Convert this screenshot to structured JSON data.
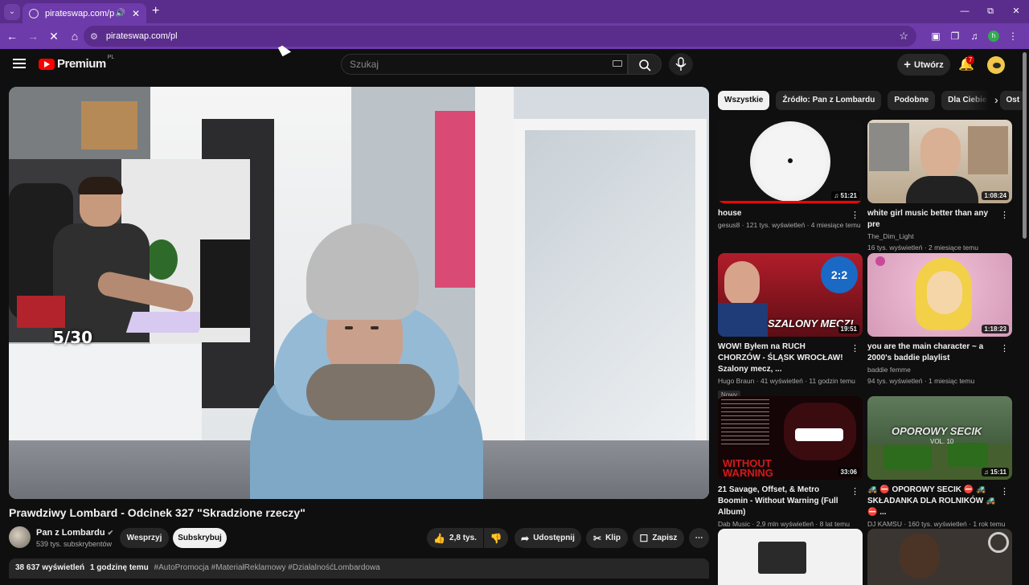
{
  "browser": {
    "tab_title": "pirateswap.com/pl",
    "url": "pirateswap.com/pl"
  },
  "youtube": {
    "logo_text": "Premium",
    "logo_country": "PL",
    "search_placeholder": "Szukaj",
    "create_label": "Utwórz",
    "notification_count": "7"
  },
  "video": {
    "title": "Prawdziwy Lombard - Odcinek 327 \"Skradzione rzeczy\"",
    "overlay_counter": "5/30",
    "channel_name": "Pan z Lombardu",
    "subscribers": "539 tys. subskrybentów",
    "support_label": "Wesprzyj",
    "subscribe_label": "Subskrybuj",
    "likes": "2,8 tys.",
    "share_label": "Udostępnij",
    "clip_label": "Klip",
    "save_label": "Zapisz",
    "views": "38 637 wyświetleń",
    "time": "1 godzinę temu",
    "tags": "#AutoPromocja #MateriałReklamowy #DziałalnośćLombardowa"
  },
  "chips": [
    "Wszystkie",
    "Źródło: Pan z Lombardu",
    "Podobne",
    "Dla Ciebie",
    "Ost"
  ],
  "recommendations": [
    {
      "title": "house",
      "channel": "gesus8",
      "stats": "121 tys. wyświetleń · 4 miesiące temu",
      "duration": "51:21",
      "progress": 1.0
    },
    {
      "title": "white girl music better than any pre",
      "channel": "The_Dim_Light",
      "stats": "16 tys. wyświetleń · 2 miesiące temu",
      "duration": "1:08:24"
    },
    {
      "title": "WOW! Byłem na RUCH CHORZÓW - ŚLĄSK WROCŁAW! Szalony mecz, ...",
      "channel": "Hugo Braun",
      "stats": "41 wyświetleń · 11 godzin temu",
      "duration": "19:51",
      "badge": "Nowy",
      "thumb_text": "SZALONY MECZ!",
      "thumb_score": "2:2"
    },
    {
      "title": "you are the main character ~ a 2000's baddie playlist",
      "channel": "baddie femme",
      "stats": "94 tys. wyświetleń · 1 miesiąc temu",
      "duration": "1:18:23"
    },
    {
      "title": "21 Savage, Offset, & Metro Boomin - Without Warning (Full Album)",
      "channel": "Dab Music",
      "stats": "2,9 mln wyświetleń · 8 lat temu",
      "duration": "33:06",
      "thumb_text": "WITHOUT WARNING"
    },
    {
      "title": "🚜 ⛔ OPOROWY SECIK ⛔ 🚜 SKŁADANKA DLA ROLNIKÓW 🚜 ⛔ ...",
      "channel": "DJ KAMSU",
      "stats": "160 tys. wyświetleń · 1 rok temu",
      "duration": "15:11",
      "thumb_text": "OPOROWY SECIK",
      "thumb_sub": "VOL. 10"
    }
  ]
}
